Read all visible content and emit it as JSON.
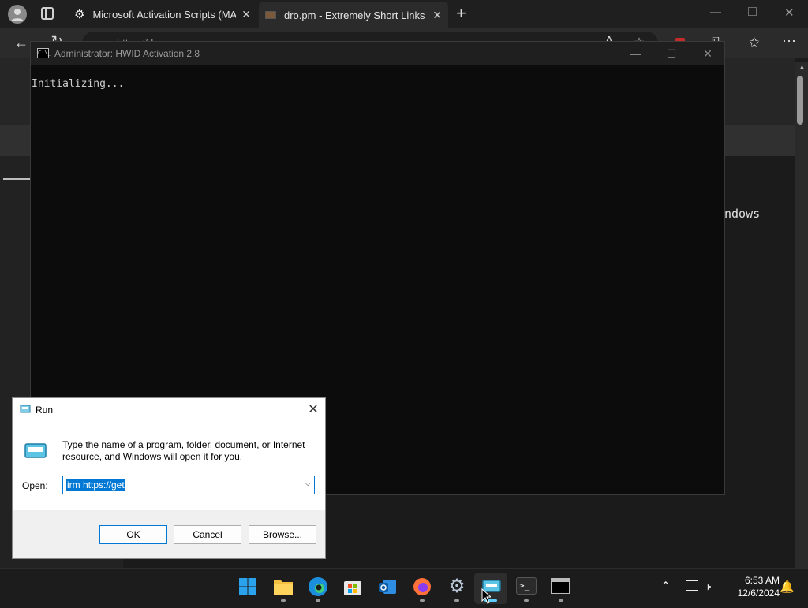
{
  "browser": {
    "tabs": [
      {
        "title": "Microsoft Activation Scripts (MAS",
        "icon": "gear-icon"
      },
      {
        "title": "dro.pm - Extremely Short Links",
        "icon": "page-icon"
      }
    ],
    "new_tab_symbol": "+",
    "address_text": "https://dro.pm",
    "page_fragment": "ndows"
  },
  "console": {
    "title": "Administrator:  HWID Activation 2.8",
    "icon_text": "C:\\_",
    "output": "Initializing..."
  },
  "run_dialog": {
    "title": "Run",
    "description": "Type the name of a program, folder, document, or Internet resource, and Windows will open it for you.",
    "open_label": "Open:",
    "input_value": "irm https://get",
    "ok_label": "OK",
    "cancel_label": "Cancel",
    "browse_label": "Browse..."
  },
  "taskbar": {
    "time": "6:53 AM",
    "date": "12/6/2024",
    "apps": [
      "start",
      "file-explorer",
      "edge",
      "store",
      "outlook",
      "firefox",
      "settings",
      "run",
      "terminal",
      "cmd"
    ]
  },
  "colors": {
    "accent": "#0078d4",
    "console_bg": "#0c0c0c",
    "taskbar_bg": "#1c1c1c"
  }
}
